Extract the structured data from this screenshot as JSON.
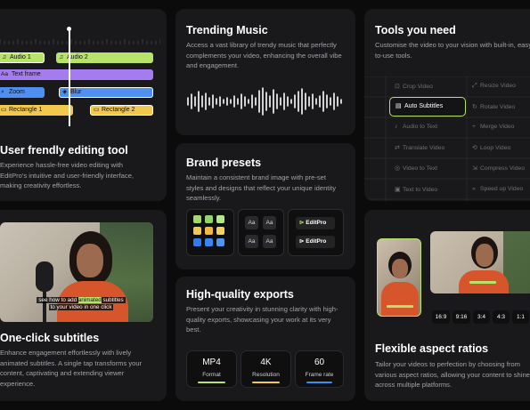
{
  "editing": {
    "clips": {
      "audio1": "Audio 1",
      "audio2": "Audio 2",
      "text_frame": "Text frame",
      "zoom": "Zoom",
      "blur": "Blur",
      "rect1": "Rectangle 1",
      "rect2": "Rectangle 2"
    },
    "title": "User frendly editing tool",
    "desc": "Experience hassle-free video editing with EditPro's intuitive and user-friendly interface, making creativity effortless."
  },
  "subtitles": {
    "caption_pre": "see how to add ",
    "caption_hl": "animated",
    "caption_post": " subtitles",
    "caption_line2": "to your video in one click",
    "title": "One-click subtitles",
    "desc": "Enhance engagement effortlessly with lively animated subtitles. A single tap transforms your content, captivating and extending viewer experience."
  },
  "music": {
    "title": "Trending Music",
    "desc": "Access a vast library of trendy music that perfectly complements your video, enhancing the overall vibe and engagement."
  },
  "brand": {
    "title": "Brand presets",
    "desc": "Maintain a consistent brand image with pre-set styles and designs that reflect your unique identity seamlessly.",
    "swatch_colors": [
      "#9fd86b",
      "#8fd46a",
      "#b5e58a",
      "#f2c94c",
      "#f2b93b",
      "#f4d25c",
      "#2f7bea",
      "#3a86f0",
      "#5094f2"
    ],
    "font_samples": [
      "Aa",
      "Aa",
      "Aa",
      "Aa"
    ],
    "logos": [
      "EditPro",
      "EditPro"
    ]
  },
  "exports": {
    "title": "High-quality exports",
    "desc": "Present your creativity in stunning clarity with high-quality exports, showcasing your work at its very best.",
    "items": [
      {
        "value": "MP4",
        "label": "Format",
        "color": "#b8e36a"
      },
      {
        "value": "4K",
        "label": "Resolution",
        "color": "#f2c94c"
      },
      {
        "value": "60",
        "label": "Frame rate",
        "color": "#3d8bf0"
      }
    ]
  },
  "tools": {
    "title": "Tools you need",
    "desc": "Customise the video to your vision with built-in, easy-to-use tools.",
    "items": [
      "Crop Video",
      "Resize Video",
      "Auto Subtitles",
      "Rotate Video",
      "Audio to Text",
      "Merge Video",
      "Translate Video",
      "Loop Video",
      "Video to Text",
      "Compress Video",
      "Text to Video",
      "Speed up Video"
    ]
  },
  "ratios": {
    "title": "Flexible aspect ratios",
    "desc": "Tailor your videos to perfection by choosing from various aspect ratios, allowing your content to shine across multiple platforms.",
    "options": [
      "16:9",
      "9:16",
      "3:4",
      "4:3",
      "1:1"
    ]
  }
}
